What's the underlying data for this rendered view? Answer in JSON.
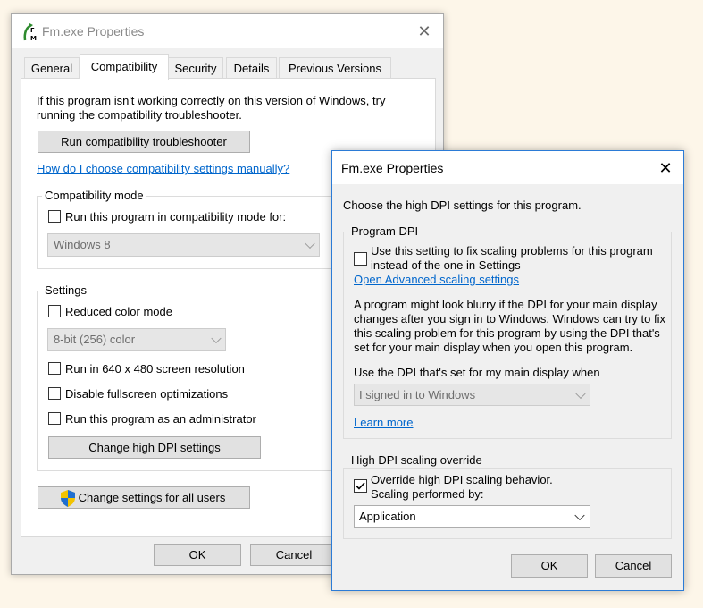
{
  "window1": {
    "title": "Fm.exe Properties",
    "app_icon_letters": [
      "F",
      "M"
    ],
    "tabs": [
      {
        "label": "General"
      },
      {
        "label": "Compatibility"
      },
      {
        "label": "Security"
      },
      {
        "label": "Details"
      },
      {
        "label": "Previous Versions"
      }
    ],
    "intro_text_1": "If this program isn't working correctly on this version of Windows, try",
    "intro_text_2": "running the compatibility troubleshooter.",
    "troubleshooter_button": "Run compatibility troubleshooter",
    "manual_link": "How do I choose compatibility settings manually?",
    "compat_mode": {
      "label": "Compatibility mode",
      "checkbox_label": "Run this program in compatibility mode for:",
      "checked": false,
      "os_value": "Windows 8"
    },
    "settings": {
      "label": "Settings",
      "reduced_color": "Reduced color mode",
      "color_value": "8-bit (256) color",
      "resolution_640": "Run in 640 x 480 screen resolution",
      "disable_fullscreen": "Disable fullscreen optimizations",
      "run_as_admin": "Run this program as an administrator",
      "dpi_button": "Change high DPI settings"
    },
    "all_users_button": "Change settings for all users",
    "ok": "OK",
    "cancel": "Cancel"
  },
  "window2": {
    "title": "Fm.exe Properties",
    "intro": "Choose the high DPI settings for this program.",
    "program_dpi": {
      "label": "Program DPI",
      "checkbox_line1": "Use this setting to fix scaling problems for this program",
      "checkbox_line2": "instead of the one in Settings",
      "checked": false,
      "advanced_link": "Open Advanced scaling settings",
      "desc_1": "A program might look blurry if the DPI for your main display",
      "desc_2": "changes after you sign in to Windows. Windows can try to fix",
      "desc_3": "this scaling problem for this program by using the DPI that's",
      "desc_4": "set for your main display when you open this program.",
      "use_dpi_label": "Use the DPI that's set for my main display when",
      "signed_in_value": "I signed in to Windows",
      "learn_more": "Learn more"
    },
    "override": {
      "label": "High DPI scaling override",
      "checkbox_line1": "Override high DPI scaling behavior.",
      "checkbox_line2": "Scaling performed by:",
      "checked": true,
      "scaling_value": "Application"
    },
    "ok": "OK",
    "cancel": "Cancel"
  },
  "colors": {
    "link": "#0066cc",
    "active_border": "#2b7bd6",
    "background": "#fdf6e9"
  }
}
